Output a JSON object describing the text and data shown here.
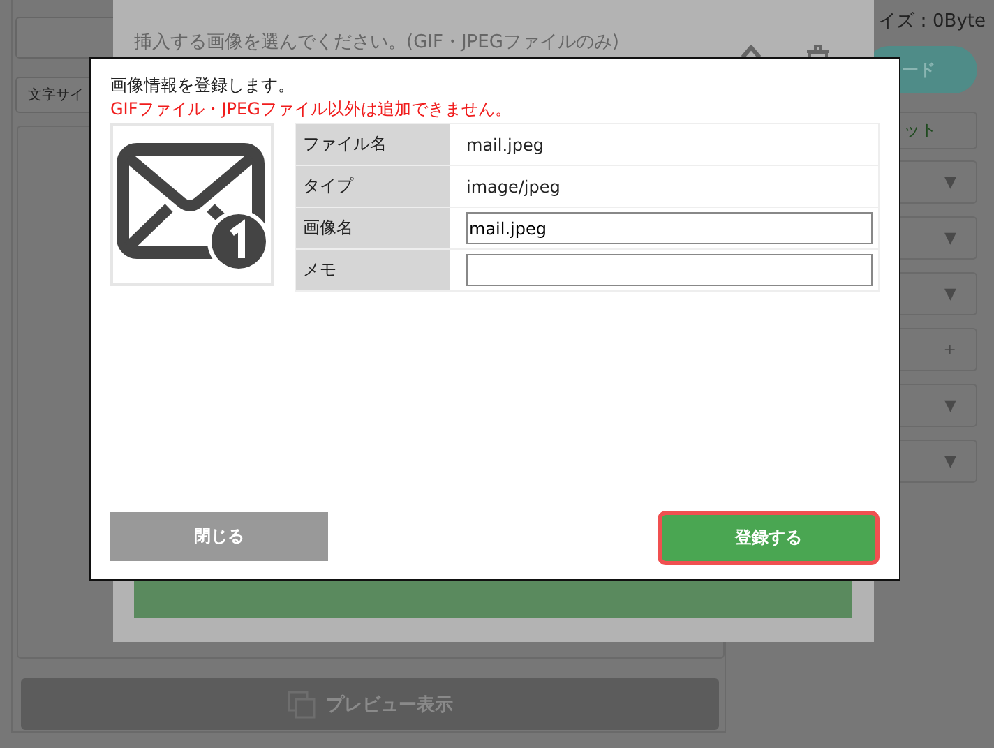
{
  "page": {
    "file_size": "イズ：0Byte",
    "upload_button": "ード",
    "reset_button": "ット",
    "text_size_select": "文字サイ",
    "preview_button": "プレビュー表示",
    "side_controls": [
      {
        "symbol": "▼"
      },
      {
        "symbol": "▼"
      },
      {
        "symbol": "▼"
      },
      {
        "symbol": "+"
      },
      {
        "symbol": "▼"
      },
      {
        "symbol": "▼"
      }
    ]
  },
  "image_dialog": {
    "instruction": "挿入する画像を選んでください。(GIF・JPEGファイルのみ)"
  },
  "modal": {
    "message": "画像情報を登録します。",
    "error": "GIFファイル・JPEGファイル以外は追加できません。",
    "fields": [
      {
        "kind": "text",
        "label": "ファイル名",
        "value": "mail.jpeg"
      },
      {
        "kind": "text",
        "label": "タイプ",
        "value": "image/jpeg"
      },
      {
        "kind": "input",
        "label": "画像名",
        "value": "mail.jpeg"
      },
      {
        "kind": "input",
        "label": "メモ"
      }
    ],
    "buttons": [
      {
        "kind": "secondary",
        "label": "閉じる",
        "focused": false
      },
      {
        "kind": "primary",
        "label": "登録する",
        "focused": true
      }
    ]
  }
}
